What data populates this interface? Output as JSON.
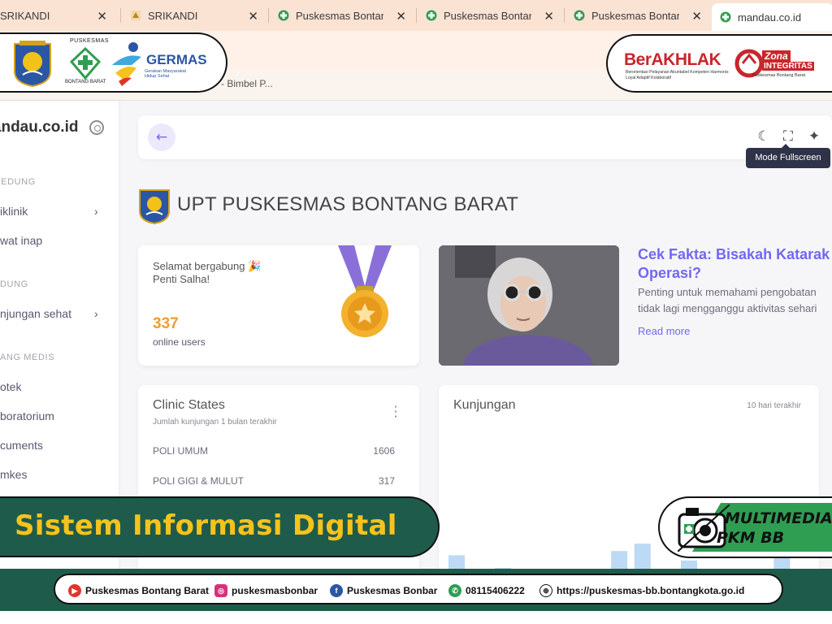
{
  "browser": {
    "tabs": [
      {
        "title": "SRIKANDI",
        "icon": "generic-page-icon"
      },
      {
        "title": "SRIKANDI",
        "icon": "srikandi-logo-icon"
      },
      {
        "title": "Puskesmas Bontan",
        "icon": "green-cross-icon"
      },
      {
        "title": "Puskesmas Bontan",
        "icon": "green-cross-icon"
      },
      {
        "title": "Puskesmas Bontan",
        "icon": "green-cross-icon"
      },
      {
        "title": "mandau.co.id",
        "icon": "green-cross-icon"
      }
    ],
    "bookmark_partial": "- Bimbel P...",
    "colors": {
      "tab_bar": "#fbe3d4"
    }
  },
  "logos_left": {
    "puskesmas_title": "PUSKESMAS",
    "puskesmas_sub": "BONTANG BARAT",
    "germas": "GERMAS",
    "germas_sub": "Gerakan Masyarakat Hidup Sehat"
  },
  "logos_right": {
    "berakhlak": "BerAKHLAK",
    "berakhlak_sub": "Berorientasi Pelayanan Akuntabel Kompeten Harmonis Loyal Adaptif Kolaboratif",
    "zona": "Zona",
    "integritas": "INTEGRITAS",
    "zona_sub": "Puskesmas Bontang Barat"
  },
  "sidebar": {
    "brand": "mandau.co.id",
    "sections": [
      {
        "header": "GEDUNG",
        "items": [
          {
            "label": "Poliklinik",
            "visible": "iklinik",
            "chevron": true
          },
          {
            "label": "Rawat inap",
            "visible": "wat inap",
            "chevron": false
          }
        ]
      },
      {
        "header": "GEDUNG",
        "header_visible": "DUNG",
        "items": [
          {
            "label": "Kunjungan sehat",
            "visible": "njungan sehat",
            "chevron": true
          }
        ]
      },
      {
        "header": "PENUNJANG MEDIS",
        "header_visible": "ANG MEDIS",
        "items": [
          {
            "label": "Apotek",
            "visible": "otek"
          },
          {
            "label": "Laboratorium",
            "visible": "boratorium"
          },
          {
            "label": "Documents",
            "visible": "cuments"
          },
          {
            "label": "Jamkes",
            "visible": "mkes"
          }
        ]
      }
    ]
  },
  "topnav": {
    "back": "arrow-left-icon",
    "icons": [
      "moon-icon",
      "fullscreen-icon",
      "sparkle-icon"
    ],
    "tooltip": "Mode Fullscreen"
  },
  "main": {
    "org_title": "UPT PUSKESMAS BONTANG BARAT",
    "welcome": {
      "greeting": "Selamat bergabung 🎉",
      "name": "Penti Salha!",
      "online_count": "337",
      "online_label": "online users"
    },
    "article": {
      "title": "Cek Fakta: Bisakah Katarak\nOperasi?",
      "title_visible": "Cek Fakta: Bisakah Katara",
      "description": "Penting untuk memahami pengobatan\ntidak lagi mengganggu aktivitas sehari",
      "read_more": "Read more"
    },
    "clinic_states": {
      "title": "Clinic States",
      "subtitle": "Jumlah kunjungan 1 bulan terakhir",
      "rows": [
        {
          "name": "POLI UMUM",
          "value": "1606"
        },
        {
          "name": "POLI GIGI & MULUT",
          "value": "317"
        }
      ]
    },
    "kunjungan": {
      "title": "Kunjungan",
      "range": "10 hari terakhir",
      "bar_levels": [
        0.62,
        0.31,
        0.5,
        0.0,
        0.0,
        0.4,
        0.0,
        0.66,
        0.73,
        0.48,
        0.57,
        0.0,
        0.0,
        0.0,
        0.62
      ],
      "bar_color": "#bcd9f5"
    }
  },
  "overlay": {
    "banner_text": "Sistem Informasi Digital",
    "multimedia_line1": "MULTIMEDIA",
    "multimedia_line2": "PKM BB",
    "colors": {
      "banner": "#1f5b4a",
      "banner_text": "#f6c31c"
    }
  },
  "footer": {
    "youtube": "Puskesmas Bontang Barat",
    "instagram": "puskesmasbonbar",
    "facebook": "Puskesmas Bonbar",
    "whatsapp": "08115406222",
    "website": "https://puskesmas-bb.bontangkota.go.id"
  }
}
